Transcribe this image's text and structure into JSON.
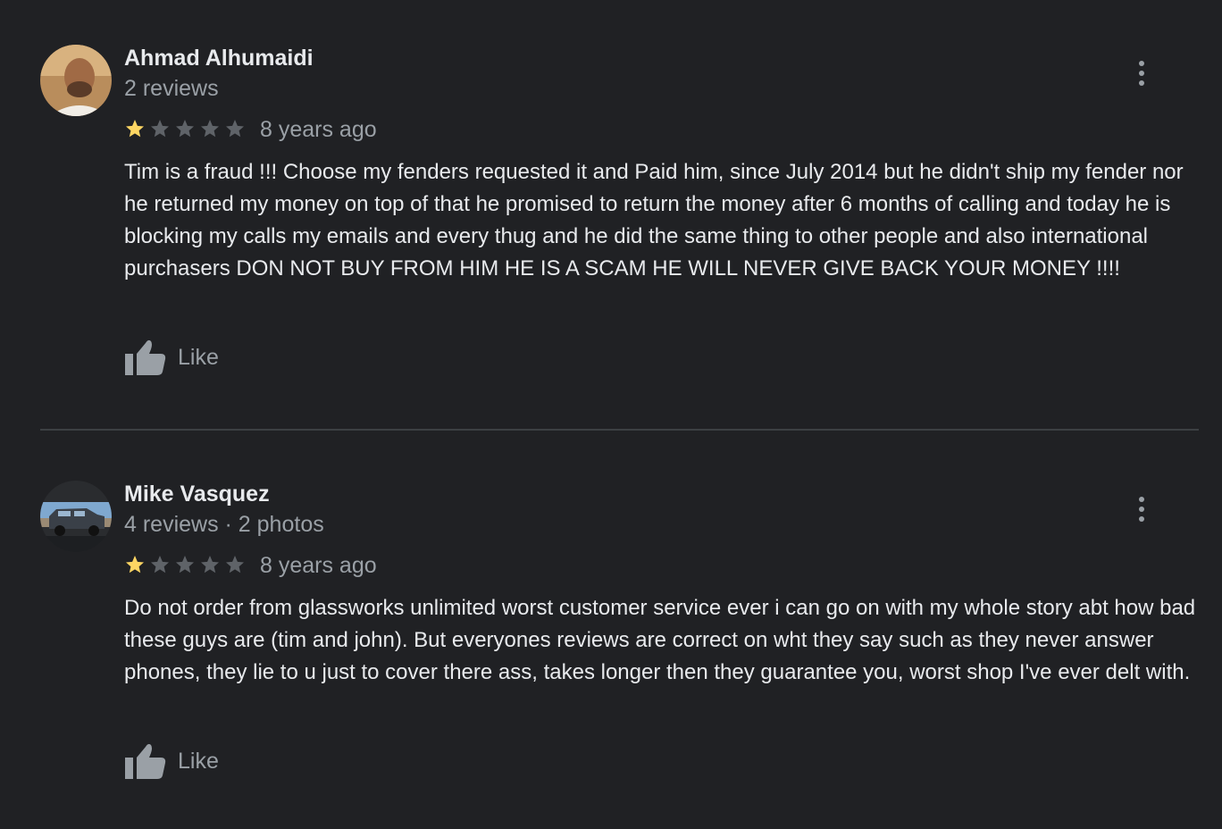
{
  "reviews": [
    {
      "author": "Ahmad Alhumaidi",
      "meta": "2 reviews",
      "rating": 1,
      "max_rating": 5,
      "time": "8 years ago",
      "text": "Tim is a fraud !!! Choose my fenders requested it and  Paid him, since July 2014 but he didn't ship my fender nor he  returned my money on top of that he promised to return the money after 6 months of calling and today he is blocking my calls my emails and every thug and he did the same thing to other people and also international purchasers DON NOT BUY FROM HIM HE IS A SCAM HE WILL NEVER GIVE BACK YOUR MONEY !!!!",
      "like_label": "Like"
    },
    {
      "author": "Mike Vasquez",
      "meta": "4 reviews · 2 photos",
      "rating": 1,
      "max_rating": 5,
      "time": "8 years ago",
      "text": "Do not order from glassworks unlimited worst customer service ever i can go on with my whole story abt how bad these guys are (tim and john). But everyones reviews are correct on wht they say such as they never answer phones, they lie to u just to cover there ass, takes longer then they guarantee you, worst shop I've ever delt with.",
      "like_label": "Like"
    }
  ],
  "icons": {
    "star_filled": "star-filled-icon",
    "star_empty": "star-empty-icon",
    "like": "thumbs-up-icon",
    "more": "more-vert-icon"
  },
  "colors": {
    "background": "#202124",
    "star_filled": "#fdd663",
    "star_empty": "#5f6368",
    "text_primary": "#e8eaed",
    "text_secondary": "#9aa0a6",
    "divider": "#3c4043"
  }
}
